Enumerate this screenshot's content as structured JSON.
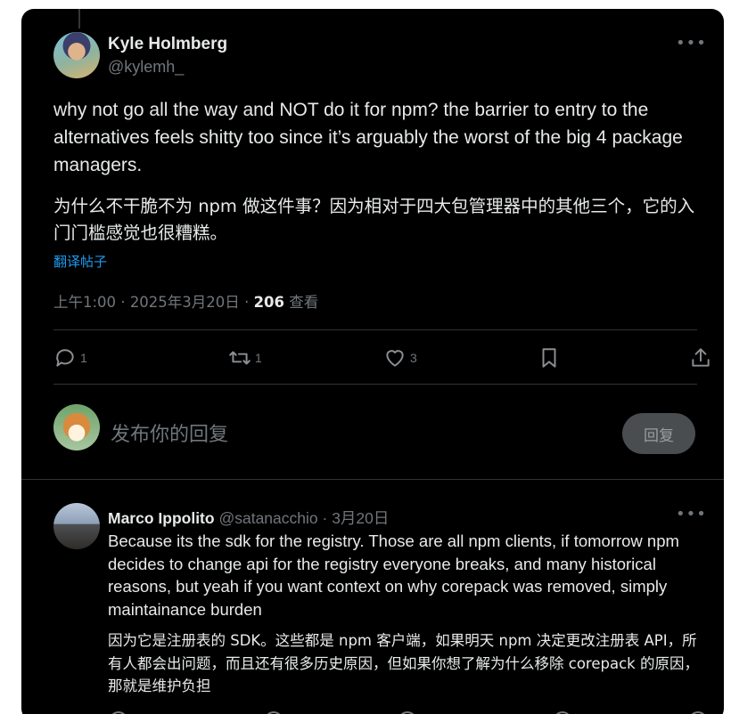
{
  "main_tweet": {
    "author_name": "Kyle Holmberg",
    "author_handle": "@kylemh_",
    "more_icon": "more-horizontal-icon",
    "text": "why not go all the way and NOT do it for npm? the barrier to entry to the alternatives feels shitty too since it’s arguably the worst of the big 4 package managers.",
    "text_translated": "为什么不干脆不为 npm 做这件事？因为相对于四大包管理器中的其他三个，它的入门门槛感觉也很糟糕。",
    "translate_link": "翻译帖子",
    "time": "上午1:00",
    "separator": "·",
    "date": "2025年3月20日",
    "views_count": "206",
    "views_label": "查看",
    "actions": {
      "reply_count": "1",
      "repost_count": "1",
      "like_count": "3"
    }
  },
  "reply_composer": {
    "placeholder": "发布你的回复",
    "button_label": "回复"
  },
  "reply_tweet": {
    "author_name": "Marco Ippolito",
    "author_handle": "@satanacchio",
    "separator": "·",
    "date": "3月20日",
    "text": "Because its the sdk for the registry. Those are all npm clients, if tomorrow npm decides to change api for the registry everyone breaks, and many historical reasons, but yeah if you want context on why corepack was removed, simply maintainance burden",
    "text_translated": "因为它是注册表的 SDK。这些都是 npm 客户端，如果明天 npm 决定更改注册表 API，所有人都会出问题，而且还有很多历史原因，但如果你想了解为什么移除 corepack 的原因，那就是维护负担"
  },
  "colors": {
    "background": "#000000",
    "text_primary": "#e7e9ea",
    "text_secondary": "#71767b",
    "link": "#1d9bf0",
    "divider": "#2f3336"
  }
}
